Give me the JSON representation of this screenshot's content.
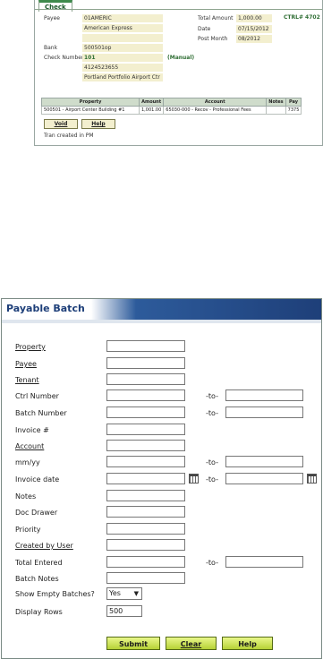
{
  "check": {
    "tab_label": "Check",
    "ctrl": "CTRL# 4702",
    "payee_label": "Payee",
    "payee_code": "01AMERIC",
    "payee_name": "American Express",
    "bank_label": "Bank",
    "bank_value": "500501op",
    "check_number_label": "Check Number",
    "check_number": "101",
    "manual": "(Manual)",
    "account_number": "4124523655",
    "location": "Portland Portfolio Airport Ctr",
    "total_amount_label": "Total Amount",
    "total_amount": "1,000.00",
    "date_label": "Date",
    "date": "07/15/2012",
    "post_month_label": "Post Month",
    "post_month": "08/2012",
    "table": {
      "headers": [
        "Property",
        "Amount",
        "Account",
        "Notes",
        "Pay"
      ],
      "rows": [
        [
          "500501 - Airport Center Building #1",
          "1,001.00",
          "65030-000 - Recov - Professional Fees",
          "",
          "7375"
        ]
      ]
    },
    "void_label": "Void",
    "help_label": "Help",
    "tran_note": "Tran created in PM"
  },
  "batch": {
    "title": "Payable Batch",
    "fields": {
      "property": "Property",
      "payee": "Payee",
      "tenant": "Tenant",
      "ctrl_number": "Ctrl Number",
      "batch_number": "Batch Number",
      "invoice": "Invoice #",
      "account": "Account",
      "mmyy": "mm/yy",
      "invoice_date": "Invoice date",
      "notes": "Notes",
      "doc_drawer": "Doc Drawer",
      "priority": "Priority",
      "created_by_user": "Created by User",
      "total_entered": "Total Entered",
      "batch_notes": "Batch Notes",
      "show_empty_batches": "Show Empty Batches?",
      "display_rows": "Display Rows"
    },
    "to_label": "-to-",
    "show_empty_value": "Yes",
    "display_rows_value": "500",
    "submit_label": "Submit",
    "clear_label": "Clear",
    "help_label": "Help"
  }
}
